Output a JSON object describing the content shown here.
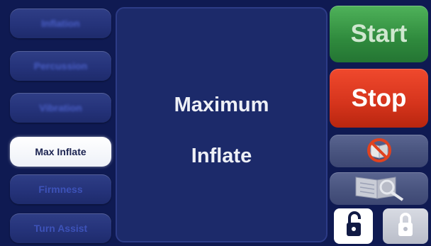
{
  "left_menu": [
    {
      "label": "Inflation",
      "state": "disabled"
    },
    {
      "label": "Percussion",
      "state": "disabled"
    },
    {
      "label": "Vibration",
      "state": "disabled"
    },
    {
      "label": "Max Inflate",
      "state": "active"
    },
    {
      "label": "Firmness",
      "state": "inactive"
    },
    {
      "label": "Turn Assist",
      "state": "inactive"
    }
  ],
  "panel": {
    "line1": "Maximum",
    "line2": "Inflate"
  },
  "controls": {
    "start_label": "Start",
    "stop_label": "Stop",
    "no_manual_icon": "prohibited-book-icon",
    "manual_icon": "book-magnifier-icon",
    "unlock_icon": "unlocked-padlock-icon",
    "lock_icon": "locked-padlock-icon"
  },
  "colors": {
    "background": "#0f1a52",
    "start": "#2f8a3d",
    "stop": "#d5341c",
    "active_item": "#ffffff"
  }
}
